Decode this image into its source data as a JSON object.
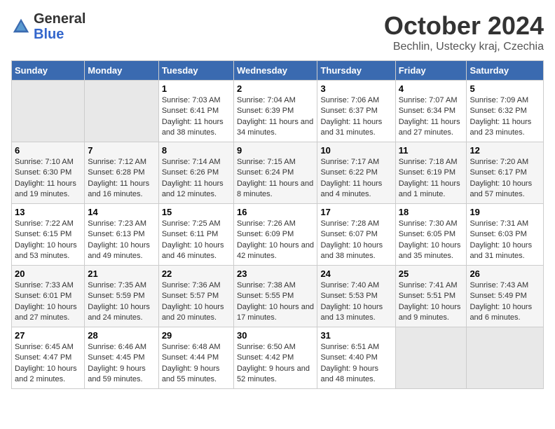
{
  "header": {
    "logo_line1": "General",
    "logo_line2": "Blue",
    "month": "October 2024",
    "location": "Bechlin, Ustecky kraj, Czechia"
  },
  "days_of_week": [
    "Sunday",
    "Monday",
    "Tuesday",
    "Wednesday",
    "Thursday",
    "Friday",
    "Saturday"
  ],
  "weeks": [
    [
      {
        "day": "",
        "sunrise": "",
        "sunset": "",
        "daylight": "",
        "empty": true
      },
      {
        "day": "",
        "sunrise": "",
        "sunset": "",
        "daylight": "",
        "empty": true
      },
      {
        "day": "1",
        "sunrise": "Sunrise: 7:03 AM",
        "sunset": "Sunset: 6:41 PM",
        "daylight": "Daylight: 11 hours and 38 minutes."
      },
      {
        "day": "2",
        "sunrise": "Sunrise: 7:04 AM",
        "sunset": "Sunset: 6:39 PM",
        "daylight": "Daylight: 11 hours and 34 minutes."
      },
      {
        "day": "3",
        "sunrise": "Sunrise: 7:06 AM",
        "sunset": "Sunset: 6:37 PM",
        "daylight": "Daylight: 11 hours and 31 minutes."
      },
      {
        "day": "4",
        "sunrise": "Sunrise: 7:07 AM",
        "sunset": "Sunset: 6:34 PM",
        "daylight": "Daylight: 11 hours and 27 minutes."
      },
      {
        "day": "5",
        "sunrise": "Sunrise: 7:09 AM",
        "sunset": "Sunset: 6:32 PM",
        "daylight": "Daylight: 11 hours and 23 minutes."
      }
    ],
    [
      {
        "day": "6",
        "sunrise": "Sunrise: 7:10 AM",
        "sunset": "Sunset: 6:30 PM",
        "daylight": "Daylight: 11 hours and 19 minutes."
      },
      {
        "day": "7",
        "sunrise": "Sunrise: 7:12 AM",
        "sunset": "Sunset: 6:28 PM",
        "daylight": "Daylight: 11 hours and 16 minutes."
      },
      {
        "day": "8",
        "sunrise": "Sunrise: 7:14 AM",
        "sunset": "Sunset: 6:26 PM",
        "daylight": "Daylight: 11 hours and 12 minutes."
      },
      {
        "day": "9",
        "sunrise": "Sunrise: 7:15 AM",
        "sunset": "Sunset: 6:24 PM",
        "daylight": "Daylight: 11 hours and 8 minutes."
      },
      {
        "day": "10",
        "sunrise": "Sunrise: 7:17 AM",
        "sunset": "Sunset: 6:22 PM",
        "daylight": "Daylight: 11 hours and 4 minutes."
      },
      {
        "day": "11",
        "sunrise": "Sunrise: 7:18 AM",
        "sunset": "Sunset: 6:19 PM",
        "daylight": "Daylight: 11 hours and 1 minute."
      },
      {
        "day": "12",
        "sunrise": "Sunrise: 7:20 AM",
        "sunset": "Sunset: 6:17 PM",
        "daylight": "Daylight: 10 hours and 57 minutes."
      }
    ],
    [
      {
        "day": "13",
        "sunrise": "Sunrise: 7:22 AM",
        "sunset": "Sunset: 6:15 PM",
        "daylight": "Daylight: 10 hours and 53 minutes."
      },
      {
        "day": "14",
        "sunrise": "Sunrise: 7:23 AM",
        "sunset": "Sunset: 6:13 PM",
        "daylight": "Daylight: 10 hours and 49 minutes."
      },
      {
        "day": "15",
        "sunrise": "Sunrise: 7:25 AM",
        "sunset": "Sunset: 6:11 PM",
        "daylight": "Daylight: 10 hours and 46 minutes."
      },
      {
        "day": "16",
        "sunrise": "Sunrise: 7:26 AM",
        "sunset": "Sunset: 6:09 PM",
        "daylight": "Daylight: 10 hours and 42 minutes."
      },
      {
        "day": "17",
        "sunrise": "Sunrise: 7:28 AM",
        "sunset": "Sunset: 6:07 PM",
        "daylight": "Daylight: 10 hours and 38 minutes."
      },
      {
        "day": "18",
        "sunrise": "Sunrise: 7:30 AM",
        "sunset": "Sunset: 6:05 PM",
        "daylight": "Daylight: 10 hours and 35 minutes."
      },
      {
        "day": "19",
        "sunrise": "Sunrise: 7:31 AM",
        "sunset": "Sunset: 6:03 PM",
        "daylight": "Daylight: 10 hours and 31 minutes."
      }
    ],
    [
      {
        "day": "20",
        "sunrise": "Sunrise: 7:33 AM",
        "sunset": "Sunset: 6:01 PM",
        "daylight": "Daylight: 10 hours and 27 minutes."
      },
      {
        "day": "21",
        "sunrise": "Sunrise: 7:35 AM",
        "sunset": "Sunset: 5:59 PM",
        "daylight": "Daylight: 10 hours and 24 minutes."
      },
      {
        "day": "22",
        "sunrise": "Sunrise: 7:36 AM",
        "sunset": "Sunset: 5:57 PM",
        "daylight": "Daylight: 10 hours and 20 minutes."
      },
      {
        "day": "23",
        "sunrise": "Sunrise: 7:38 AM",
        "sunset": "Sunset: 5:55 PM",
        "daylight": "Daylight: 10 hours and 17 minutes."
      },
      {
        "day": "24",
        "sunrise": "Sunrise: 7:40 AM",
        "sunset": "Sunset: 5:53 PM",
        "daylight": "Daylight: 10 hours and 13 minutes."
      },
      {
        "day": "25",
        "sunrise": "Sunrise: 7:41 AM",
        "sunset": "Sunset: 5:51 PM",
        "daylight": "Daylight: 10 hours and 9 minutes."
      },
      {
        "day": "26",
        "sunrise": "Sunrise: 7:43 AM",
        "sunset": "Sunset: 5:49 PM",
        "daylight": "Daylight: 10 hours and 6 minutes."
      }
    ],
    [
      {
        "day": "27",
        "sunrise": "Sunrise: 6:45 AM",
        "sunset": "Sunset: 4:47 PM",
        "daylight": "Daylight: 10 hours and 2 minutes."
      },
      {
        "day": "28",
        "sunrise": "Sunrise: 6:46 AM",
        "sunset": "Sunset: 4:45 PM",
        "daylight": "Daylight: 9 hours and 59 minutes."
      },
      {
        "day": "29",
        "sunrise": "Sunrise: 6:48 AM",
        "sunset": "Sunset: 4:44 PM",
        "daylight": "Daylight: 9 hours and 55 minutes."
      },
      {
        "day": "30",
        "sunrise": "Sunrise: 6:50 AM",
        "sunset": "Sunset: 4:42 PM",
        "daylight": "Daylight: 9 hours and 52 minutes."
      },
      {
        "day": "31",
        "sunrise": "Sunrise: 6:51 AM",
        "sunset": "Sunset: 4:40 PM",
        "daylight": "Daylight: 9 hours and 48 minutes."
      },
      {
        "day": "",
        "sunrise": "",
        "sunset": "",
        "daylight": "",
        "empty": true
      },
      {
        "day": "",
        "sunrise": "",
        "sunset": "",
        "daylight": "",
        "empty": true
      }
    ]
  ]
}
